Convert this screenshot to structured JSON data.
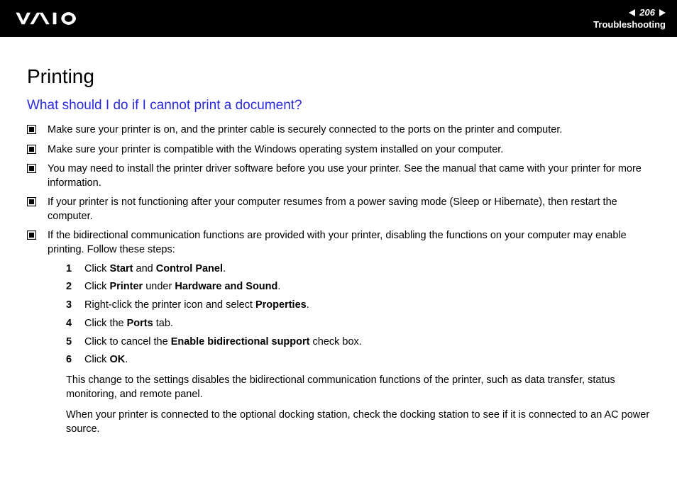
{
  "header": {
    "page_number": "206",
    "section": "Troubleshooting"
  },
  "page": {
    "title": "Printing",
    "question": "What should I do if I cannot print a document?"
  },
  "bullets": [
    "Make sure your printer is on, and the printer cable is securely connected to the ports on the printer and computer.",
    "Make sure your printer is compatible with the Windows operating system installed on your computer.",
    "You may need to install the printer driver software before you use your printer. See the manual that came with your printer for more information.",
    "If your printer is not functioning after your computer resumes from a power saving mode (Sleep or Hibernate), then restart the computer.",
    "If the bidirectional communication functions are provided with your printer, disabling the functions on your computer may enable printing. Follow these steps:"
  ],
  "steps": {
    "s1": {
      "pre": "Click ",
      "b1": "Start",
      "mid": " and ",
      "b2": "Control Panel",
      "post": "."
    },
    "s2": {
      "pre": "Click ",
      "b1": "Printer",
      "mid": " under ",
      "b2": "Hardware and Sound",
      "post": "."
    },
    "s3": {
      "pre": "Right-click the printer icon and select ",
      "b1": "Properties",
      "post": "."
    },
    "s4": {
      "pre": "Click the ",
      "b1": "Ports",
      "post": " tab."
    },
    "s5": {
      "pre": "Click to cancel the ",
      "b1": "Enable bidirectional support",
      "post": " check box."
    },
    "s6": {
      "pre": "Click ",
      "b1": "OK",
      "post": "."
    }
  },
  "after": {
    "p1": "This change to the settings disables the bidirectional communication functions of the printer, such as data transfer, status monitoring, and remote panel.",
    "p2": "When your printer is connected to the optional docking station, check the docking station to see if it is connected to an AC power source."
  }
}
